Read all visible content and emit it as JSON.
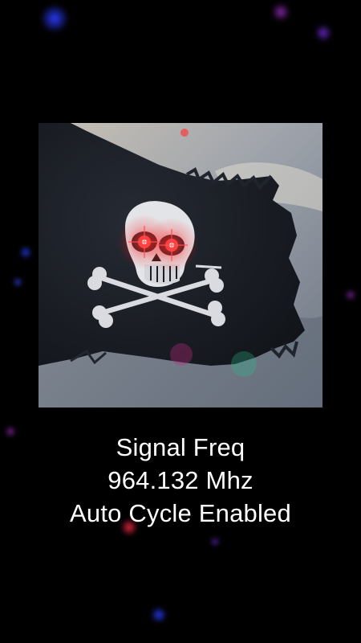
{
  "flag_image": {
    "icon": "jolly-roger-skull-crossbones-icon",
    "eye_color": "#ff2a2a"
  },
  "signal": {
    "label": "Signal Freq",
    "frequency": "964.132 Mhz",
    "status": "Auto Cycle Enabled"
  },
  "colors": {
    "background": "#000000",
    "text": "#ffffff",
    "particle_blue": "#2a3cff",
    "particle_purple": "#9a2ab8",
    "particle_red": "#ff2a4a"
  }
}
